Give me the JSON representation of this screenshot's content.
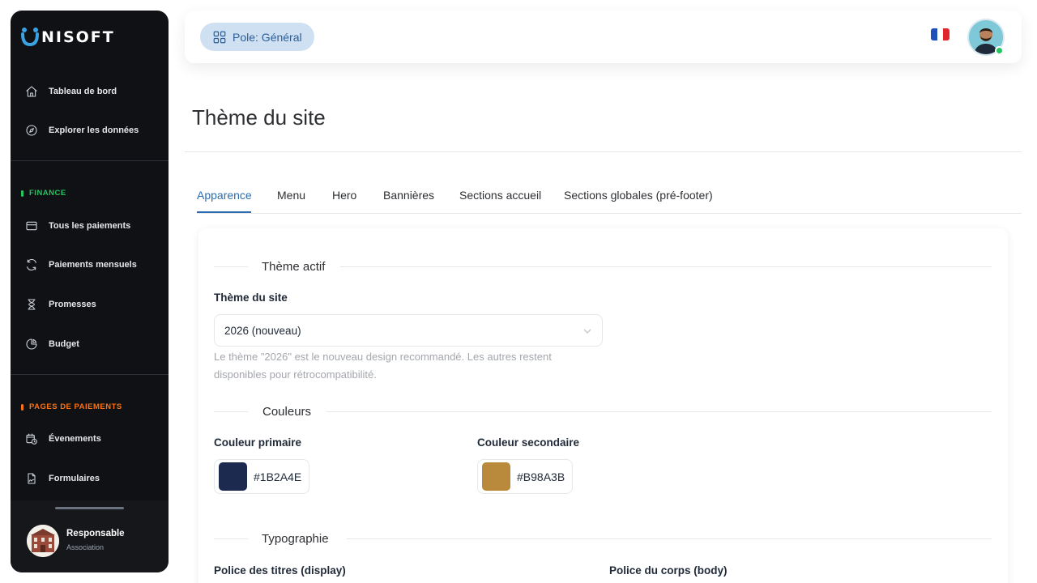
{
  "brand": {
    "name": "NISOFT"
  },
  "sidebar": {
    "top_items": [
      {
        "label": "Tableau de bord",
        "icon": "home-icon"
      },
      {
        "label": "Explorer les données",
        "icon": "compass-icon"
      }
    ],
    "finance": {
      "label": "FINANCE",
      "color": "#22c55e",
      "items": [
        {
          "label": "Tous les paiements",
          "icon": "credit-card-icon"
        },
        {
          "label": "Paiements mensuels",
          "icon": "refresh-icon"
        },
        {
          "label": "Promesses",
          "icon": "hourglass-icon"
        },
        {
          "label": "Budget",
          "icon": "pie-chart-icon"
        }
      ]
    },
    "payment_pages": {
      "label": "PAGES DE PAIEMENTS",
      "color": "#f97316",
      "items": [
        {
          "label": "Évenements",
          "icon": "calendar-clock-icon"
        },
        {
          "label": "Formulaires",
          "icon": "file-signature-icon"
        }
      ]
    },
    "user": {
      "name": "Responsable",
      "role": "Association"
    }
  },
  "header": {
    "pole_label": "Pole: Général",
    "language_flag": "flag-fr-icon"
  },
  "page": {
    "title": "Thème du site",
    "tabs": [
      {
        "label": "Apparence",
        "active": true
      },
      {
        "label": "Menu",
        "active": false
      },
      {
        "label": "Hero",
        "active": false
      },
      {
        "label": "Bannières",
        "active": false
      },
      {
        "label": "Sections accueil",
        "active": false
      },
      {
        "label": "Sections globales (pré-footer)",
        "active": false
      }
    ]
  },
  "theme": {
    "section_title": "Thème actif",
    "field_label": "Thème du site",
    "selected_value": "2026 (nouveau)",
    "hint": "Le thème \"2026\" est le nouveau design recommandé. Les autres restent disponibles pour rétrocompatibilité."
  },
  "colors": {
    "section_title": "Couleurs",
    "primary": {
      "label": "Couleur primaire",
      "value": "#1B2A4E"
    },
    "secondary": {
      "label": "Couleur secondaire",
      "value": "#B98A3B"
    }
  },
  "typography": {
    "section_title": "Typographie",
    "display_label": "Police des titres (display)",
    "body_label": "Police du corps (body)"
  }
}
